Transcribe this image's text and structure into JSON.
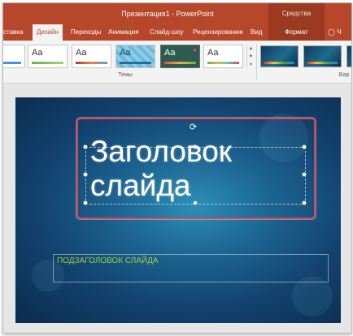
{
  "window": {
    "title": "Презентация1 - PowerPoint",
    "tools_group_header": "Средства рисования"
  },
  "tabs": [
    {
      "label": "ставка",
      "active": false
    },
    {
      "label": "Дизайн",
      "active": true
    },
    {
      "label": "Переходы",
      "active": false
    },
    {
      "label": "Анимация",
      "active": false
    },
    {
      "label": "Слайд-шоу",
      "active": false
    },
    {
      "label": "Рецензирование",
      "active": false
    },
    {
      "label": "Вид",
      "active": false
    },
    {
      "label": "Формат",
      "active": false
    }
  ],
  "tell_me": {
    "icon": "lightbulb-icon",
    "text": "Ч"
  },
  "ribbon": {
    "themes_label": "Темы",
    "variants_label": "Вар",
    "themes": [
      {
        "text": "",
        "bg": "#ffffff",
        "accent": "#4a90d9"
      },
      {
        "text": "Aa",
        "bg": "#ffffff",
        "accent": "#6ab04c"
      },
      {
        "text": "Aa",
        "bg": "#ffffff",
        "accent": "#b03a2e"
      },
      {
        "text": "Aa",
        "bg": "#8ecfe8",
        "accent": "#1f6fa3"
      },
      {
        "text": "Aa",
        "bg": "#2e5b4f",
        "accent": "#d9534f"
      },
      {
        "text": "Aa",
        "bg": "#ffffff",
        "accent": "#5cb85c"
      }
    ]
  },
  "slide": {
    "title": "Заголовок слайда",
    "subtitle": "ПОДЗАГОЛОВОК СЛАЙДА",
    "subtitle_color": "#9bd13c",
    "highlight_color": "#e0424d"
  },
  "colors": {
    "ribbon_accent": "#b7472a",
    "tools_tab": "#9b3a21"
  }
}
